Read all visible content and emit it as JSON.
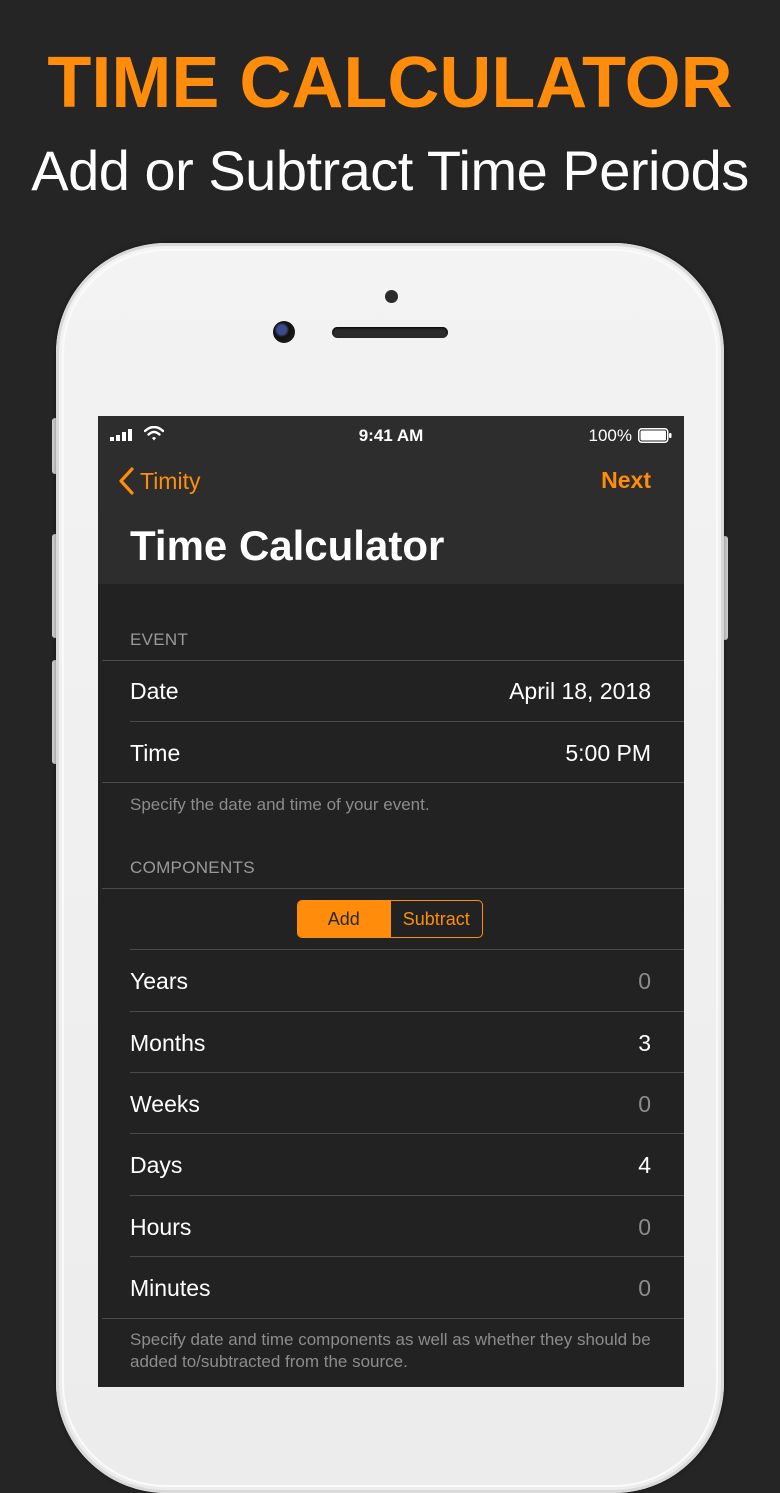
{
  "promo": {
    "title": "TIME CALCULATOR",
    "subtitle": "Add or Subtract Time Periods"
  },
  "status_bar": {
    "time": "9:41 AM",
    "battery": "100%"
  },
  "nav": {
    "back_label": "Timity",
    "next_label": "Next",
    "title": "Time Calculator"
  },
  "event": {
    "header": "EVENT",
    "date_label": "Date",
    "date_value": "April 18, 2018",
    "time_label": "Time",
    "time_value": "5:00 PM",
    "footer": "Specify the date and time of your event."
  },
  "components": {
    "header": "COMPONENTS",
    "segment_add": "Add",
    "segment_subtract": "Subtract",
    "selected_segment": "Add",
    "rows": [
      {
        "label": "Years",
        "value": "0"
      },
      {
        "label": "Months",
        "value": "3"
      },
      {
        "label": "Weeks",
        "value": "0"
      },
      {
        "label": "Days",
        "value": "4"
      },
      {
        "label": "Hours",
        "value": "0"
      },
      {
        "label": "Minutes",
        "value": "0"
      }
    ],
    "footer": "Specify date and time components as well as whether they should be added to/subtracted from the source."
  },
  "colors": {
    "accent": "#ff8c0b",
    "background": "#252525",
    "screen_bg": "#222222"
  }
}
